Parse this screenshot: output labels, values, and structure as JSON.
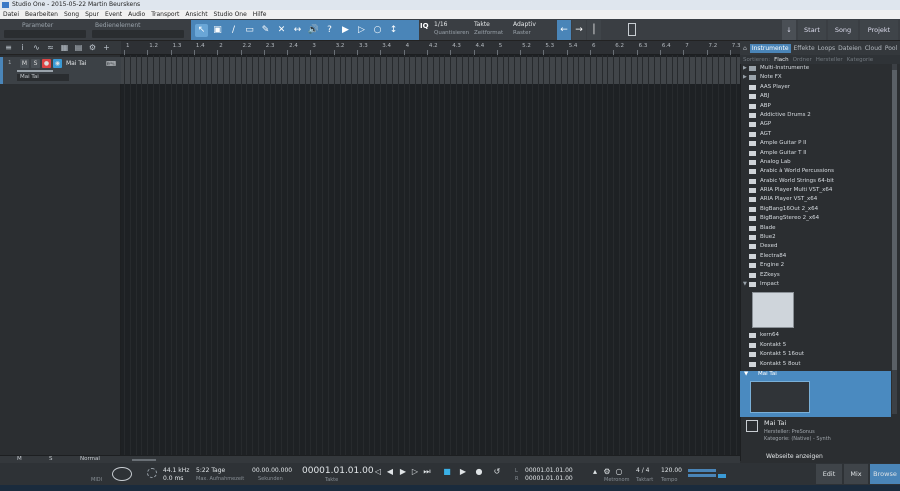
{
  "window": {
    "title": "Studio One - 2015-05-22 Martin Beurskens"
  },
  "menu": [
    "Datei",
    "Bearbeiten",
    "Song",
    "Spur",
    "Event",
    "Audio",
    "Transport",
    "Ansicht",
    "Studio One",
    "Hilfe"
  ],
  "toolbar": {
    "param_label": "Parameter",
    "control_label": "Bedienelement",
    "iq": "IQ",
    "quant_value": "1/16",
    "quant_label": "Quantisieren",
    "timebase_value": "Takte",
    "timebase_label": "Zeitformat",
    "snap_value": "Adaptiv",
    "snap_label": "Raster",
    "start_label": "Start",
    "song_label": "Song",
    "project_label": "Projekt"
  },
  "ruler": {
    "ticks": [
      "1",
      "1.2",
      "1.3",
      "1.4",
      "2",
      "2.2",
      "2.3",
      "2.4",
      "3",
      "3.2",
      "3.3",
      "3.4",
      "4",
      "4.2",
      "4.3",
      "4.4",
      "5",
      "5.2",
      "5.3",
      "5.4",
      "6",
      "6.2",
      "6.3",
      "6.4",
      "7",
      "7.2",
      "7.3"
    ]
  },
  "track": {
    "number": "1",
    "mute": "M",
    "solo": "S",
    "name": "Mai Tai",
    "instrument": "Mai Tai"
  },
  "browser": {
    "tabs": [
      "Instrumente",
      "Effekte",
      "Loops",
      "Dateien",
      "Cloud",
      "Pool"
    ],
    "subtabs": [
      "Sortieren:",
      "Flach",
      "Ordner",
      "Hersteller",
      "Kategorie"
    ],
    "items": [
      "Multi-Instrumente",
      "Note FX",
      "AAS Player",
      "ABJ",
      "ABP",
      "Addictive Drums 2",
      "AGP",
      "AGT",
      "Ample Guitar P II",
      "Ample Guitar T II",
      "Analog Lab",
      "Arabic à World Percussions",
      "Arabic World Strings 64-bit",
      "ARIA Player Multi VST_x64",
      "ARIA Player VST_x64",
      "BigBang16Out 2_x64",
      "BigBangStereo 2_x64",
      "Blade",
      "Blue2",
      "Dexed",
      "Electra84",
      "Engine 2",
      "EZkeys",
      "Impact"
    ],
    "items_after": [
      "kern64",
      "Kontakt 5",
      "Kontakt 5 16out",
      "Kontakt 5 8out"
    ],
    "selected": "Mai Tai",
    "info_name": "Mai Tai",
    "info_maker": "Hersteller:  PreSonus",
    "info_cat": "Kategorie:  (Native) - Synth",
    "web_button": "Webseite anzeigen"
  },
  "footer": {
    "m": "M",
    "s": "S",
    "normal": "Normal"
  },
  "transport": {
    "midi": "MIDI",
    "rate": "44.1 kHz",
    "latency": "0.0 ms",
    "rec_days": "5:22 Tage",
    "rec_label": "Max. Aufnahmezeit",
    "seconds": "00.00.00.000",
    "seconds_label": "Sekunden",
    "position": "00001.01.01.00",
    "position_label": "Takte",
    "loop_l": "00001.01.01.00",
    "loop_r": "00001.01.01.00",
    "metronome_label": "Metronom",
    "signature": "4 / 4",
    "signature_label": "Taktart",
    "tempo": "120.00",
    "tempo_label": "Tempo",
    "edit": "Edit",
    "mix": "Mix",
    "browse": "Browse"
  }
}
